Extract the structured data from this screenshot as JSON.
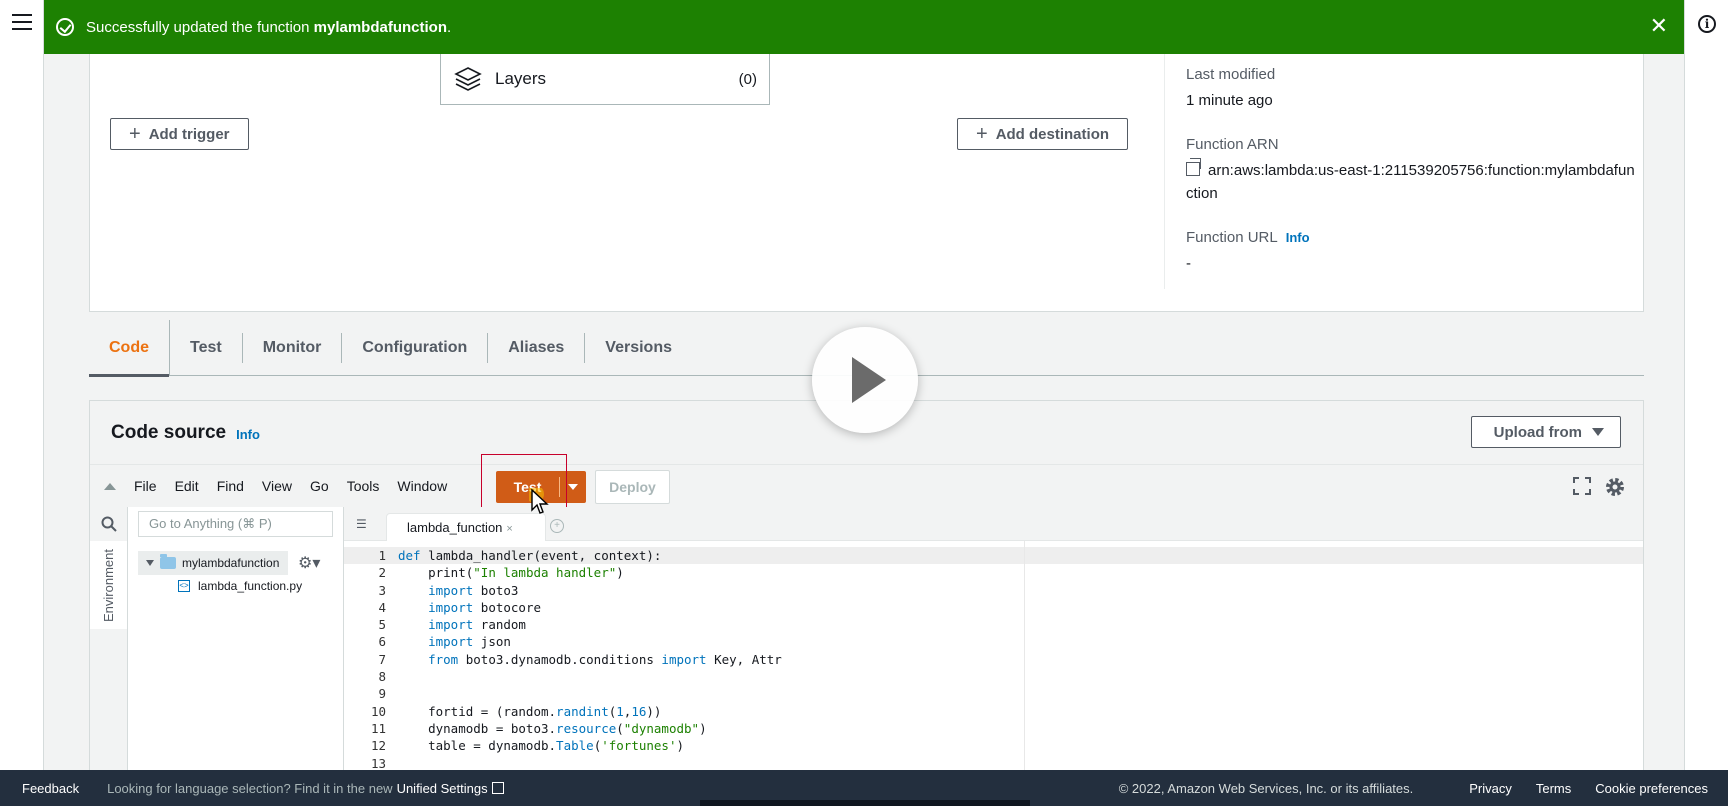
{
  "flash": {
    "message_prefix": "Successfully updated the function ",
    "function_name": "mylambdafunction",
    "message_suffix": ".",
    "close_glyph": "✕"
  },
  "overview": {
    "layers_label": "Layers",
    "layers_count": "(0)",
    "add_trigger_label": "Add trigger",
    "add_destination_label": "Add destination",
    "last_modified_key": "Last modified",
    "last_modified_value": "1 minute ago",
    "arn_key": "Function ARN",
    "arn_value": "arn:aws:lambda:us-east-1:211539205756:function:mylambdafunction",
    "url_key": "Function URL",
    "url_info": "Info",
    "url_value": "-"
  },
  "tabs": [
    "Code",
    "Test",
    "Monitor",
    "Configuration",
    "Aliases",
    "Versions"
  ],
  "active_tab": "Code",
  "code_source": {
    "title": "Code source",
    "info": "Info",
    "upload_label": "Upload from",
    "menu": [
      "File",
      "Edit",
      "Find",
      "View",
      "Go",
      "Tools",
      "Window"
    ],
    "test_label": "Test",
    "deploy_label": "Deploy",
    "goto_placeholder": "Go to Anything (⌘ P)",
    "environment_label": "Environment",
    "folder_name": "mylambdafunction",
    "file_name": "lambda_function.py",
    "open_tab": "lambda_function",
    "tab_close": "×"
  },
  "code_lines": [
    "def lambda_handler(event, context):",
    "    print(\"In lambda handler\")",
    "    import boto3",
    "    import botocore",
    "    import random",
    "    import json",
    "    from boto3.dynamodb.conditions import Key, Attr",
    "",
    "",
    "    fortid = (random.randint(1,16))",
    "    dynamodb = boto3.resource(\"dynamodb\")",
    "    table = dynamodb.Table('fortunes')",
    ""
  ],
  "footer": {
    "feedback": "Feedback",
    "lang_prompt": "Looking for language selection? Find it in the new",
    "unified_settings": "Unified Settings",
    "copyright": "© 2022, Amazon Web Services, Inc. or its affiliates.",
    "privacy": "Privacy",
    "terms": "Terms",
    "cookie": "Cookie preferences"
  },
  "colors": {
    "flash_bg": "#1d8102",
    "active_tab": "#ec7211",
    "test_button": "#d05c17",
    "footer_bg": "#232f3e",
    "link": "#0073bb"
  },
  "icons": [
    "menu-icon",
    "info-icon",
    "check-circle-icon",
    "close-icon",
    "layers-icon",
    "plus-icon",
    "copy-icon",
    "caret-down-icon",
    "collapse-triangle-icon",
    "fullscreen-icon",
    "gear-icon",
    "search-icon",
    "folder-icon",
    "python-file-icon",
    "play-icon",
    "mouse-cursor-icon",
    "external-link-icon"
  ]
}
